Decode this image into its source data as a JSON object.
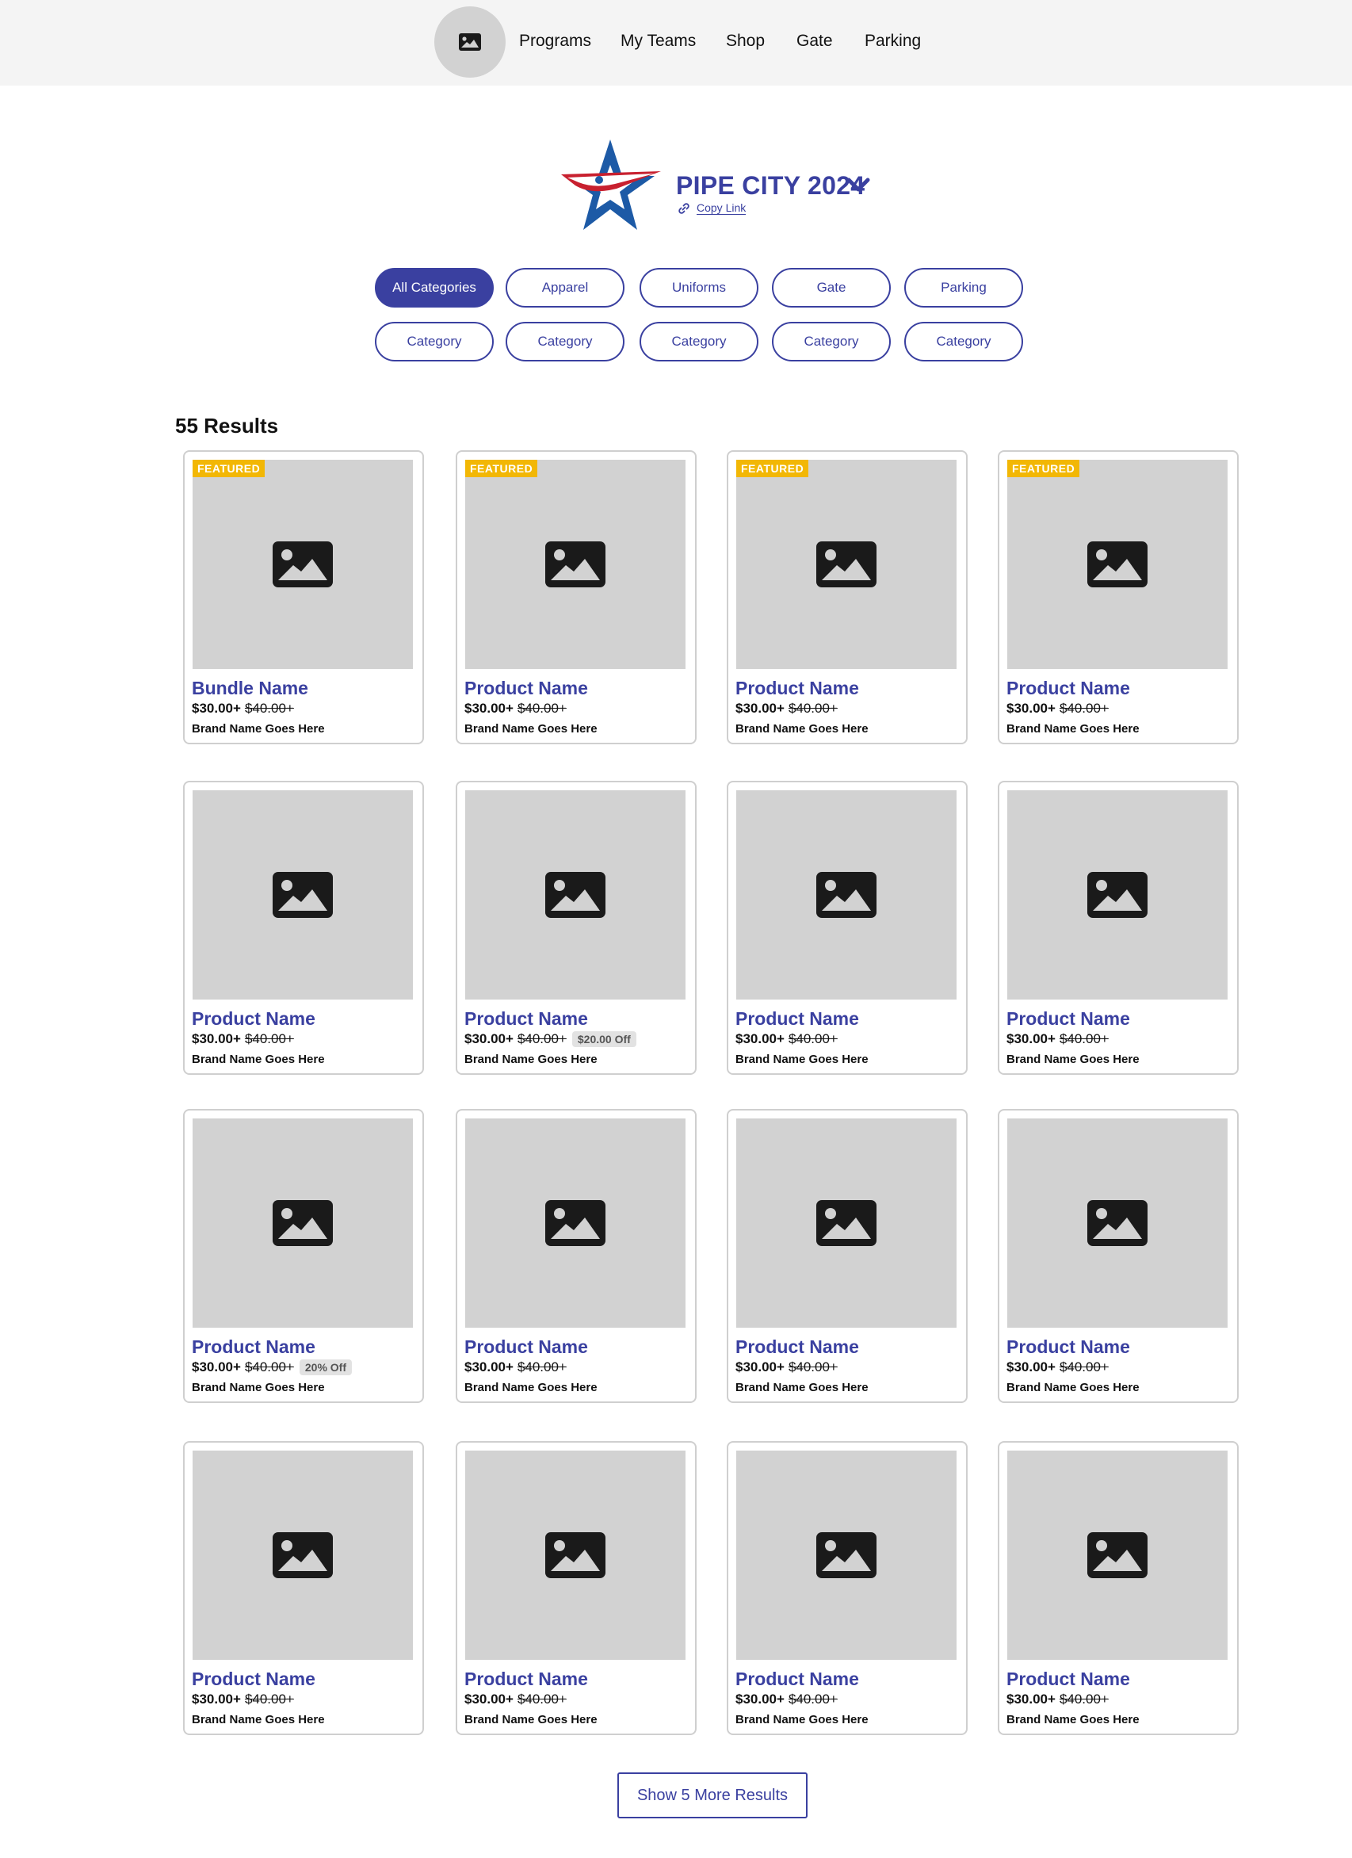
{
  "nav": {
    "logo_icon": "image-placeholder-icon",
    "items": [
      "Programs",
      "My Teams",
      "Shop",
      "Gate",
      "Parking"
    ]
  },
  "org": {
    "name": "PIPE CITY 2024",
    "copy_link_label": "Copy Link",
    "dropdown_icon": "chevron-down-icon",
    "link_icon": "link-icon"
  },
  "categories": {
    "row1": [
      "All Categories",
      "Apparel",
      "Uniforms",
      "Gate",
      "Parking"
    ],
    "row2": [
      "Category",
      "Category",
      "Category",
      "Category",
      "Category"
    ],
    "active": "All Categories"
  },
  "results": {
    "title": "55 Results",
    "featured_label": "FEATURED",
    "products": [
      {
        "name": "Bundle Name",
        "price": "$30.00+",
        "was": "$40.00+",
        "discount": "",
        "brand": "Brand Name Goes Here",
        "featured": true
      },
      {
        "name": "Product Name",
        "price": "$30.00+",
        "was": "$40.00+",
        "discount": "",
        "brand": "Brand Name Goes Here",
        "featured": true
      },
      {
        "name": "Product Name",
        "price": "$30.00+",
        "was": "$40.00+",
        "discount": "",
        "brand": "Brand Name Goes Here",
        "featured": true
      },
      {
        "name": "Product Name",
        "price": "$30.00+",
        "was": "$40.00+",
        "discount": "",
        "brand": "Brand Name Goes Here",
        "featured": true
      },
      {
        "name": "Product Name",
        "price": "$30.00+",
        "was": "$40.00+",
        "discount": "",
        "brand": "Brand Name Goes Here",
        "featured": false
      },
      {
        "name": "Product Name",
        "price": "$30.00+",
        "was": "$40.00+",
        "discount": "$20.00 Off",
        "brand": "Brand Name Goes Here",
        "featured": false
      },
      {
        "name": "Product Name",
        "price": "$30.00+",
        "was": "$40.00+",
        "discount": "",
        "brand": "Brand Name Goes Here",
        "featured": false
      },
      {
        "name": "Product Name",
        "price": "$30.00+",
        "was": "$40.00+",
        "discount": "",
        "brand": "Brand Name Goes Here",
        "featured": false
      },
      {
        "name": "Product Name",
        "price": "$30.00+",
        "was": "$40.00+",
        "discount": "20% Off",
        "brand": "Brand Name Goes Here",
        "featured": false
      },
      {
        "name": "Product Name",
        "price": "$30.00+",
        "was": "$40.00+",
        "discount": "",
        "brand": "Brand Name Goes Here",
        "featured": false
      },
      {
        "name": "Product Name",
        "price": "$30.00+",
        "was": "$40.00+",
        "discount": "",
        "brand": "Brand Name Goes Here",
        "featured": false
      },
      {
        "name": "Product Name",
        "price": "$30.00+",
        "was": "$40.00+",
        "discount": "",
        "brand": "Brand Name Goes Here",
        "featured": false
      },
      {
        "name": "Product Name",
        "price": "$30.00+",
        "was": "$40.00+",
        "discount": "",
        "brand": "Brand Name Goes Here",
        "featured": false
      },
      {
        "name": "Product Name",
        "price": "$30.00+",
        "was": "$40.00+",
        "discount": "",
        "brand": "Brand Name Goes Here",
        "featured": false
      },
      {
        "name": "Product Name",
        "price": "$30.00+",
        "was": "$40.00+",
        "discount": "",
        "brand": "Brand Name Goes Here",
        "featured": false
      },
      {
        "name": "Product Name",
        "price": "$30.00+",
        "was": "$40.00+",
        "discount": "",
        "brand": "Brand Name Goes Here",
        "featured": false
      }
    ],
    "show_more_label": "Show 5 More Results"
  },
  "colors": {
    "brand": "#3a40a0",
    "featured": "#f2b705",
    "placeholder": "#d2d2d2",
    "nav_bg": "#f4f4f4"
  }
}
